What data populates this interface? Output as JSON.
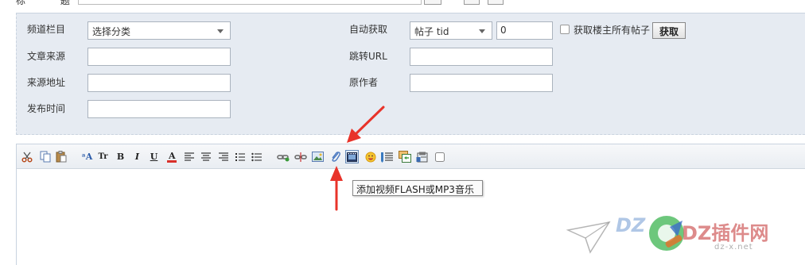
{
  "top": {
    "title_label": "标 题"
  },
  "form": {
    "channel_label": "频道栏目",
    "channel_select": "选择分类",
    "source_label": "文章来源",
    "source_value": "",
    "source_url_label": "来源地址",
    "source_url_value": "",
    "publish_time_label": "发布时间",
    "publish_time_value": "",
    "auto_fetch_label": "自动获取",
    "auto_fetch_select": "帖子 tid",
    "tid_value": "0",
    "fetch_all_label": "获取楼主所有帖子",
    "fetch_button": "获取",
    "redirect_label": "跳转URL",
    "redirect_value": "",
    "author_label": "原作者",
    "author_value": ""
  },
  "toolbar": {
    "buttons": [
      "cut",
      "copy",
      "paste",
      "font-family",
      "font-size",
      "bold",
      "italic",
      "underline",
      "font-color",
      "align-left",
      "align-center",
      "align-right",
      "ordered-list",
      "unordered-list",
      "link",
      "unlink",
      "image",
      "attachment",
      "flash-media",
      "emoticon",
      "quote",
      "code",
      "table",
      "checkbox"
    ],
    "tooltip": "添加视频FLASH或MP3音乐"
  },
  "watermark": {
    "logo": "DZ",
    "brand": "DZ插件网",
    "sub": "dz-x.net"
  },
  "colors": {
    "panel_bg": "#e6ebf2",
    "arrow": "#e8332a",
    "font_color_bar": "#d9302a"
  }
}
